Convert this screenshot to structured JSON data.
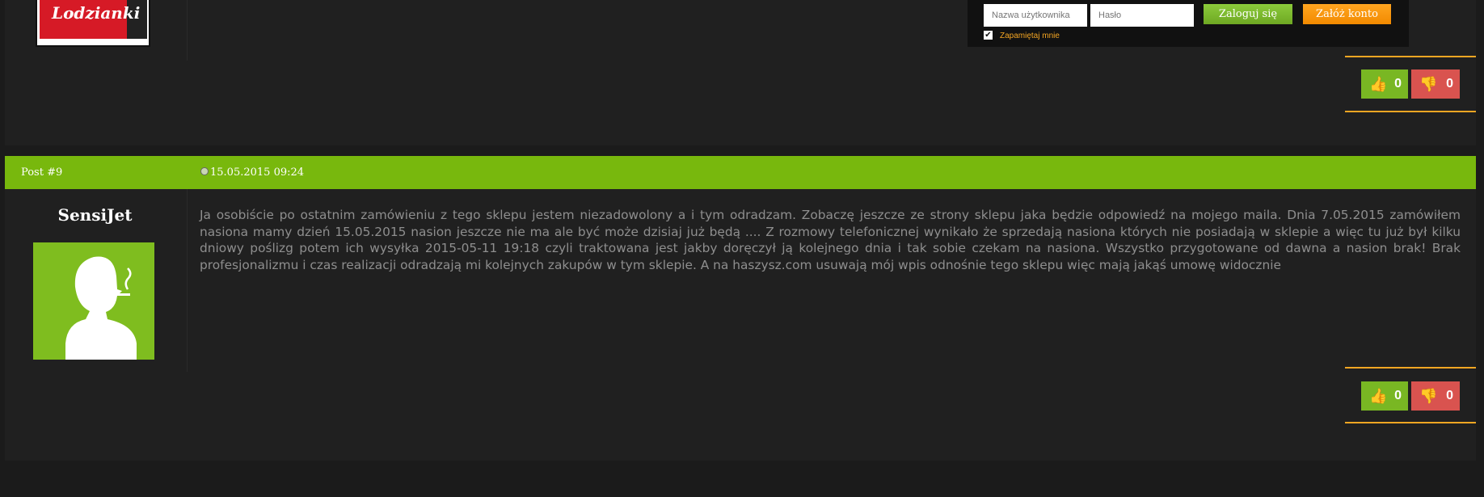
{
  "previous_post": {
    "avatar_text": "Lodzianki"
  },
  "login": {
    "username_placeholder": "Nazwa użytkownika",
    "password_placeholder": "Hasło",
    "login_button": "Zaloguj się",
    "register_button": "Załóż konto",
    "remember_label": "Zapamiętaj mnie",
    "remember_checked": true
  },
  "votes_previous": {
    "up": "0",
    "down": "0"
  },
  "post": {
    "number": "Post #9",
    "date": "15.05.2015 09:24",
    "author": "SensiJet",
    "body": "Ja osobiście po ostatnim zamówieniu z tego sklepu jestem niezadowolony a i tym odradzam. Zobaczę jeszcze ze strony sklepu jaka będzie odpowiedź na mojego maila. Dnia 7.05.2015 zamówiłem nasiona mamy dzień 15.05.2015 nasion jeszcze nie ma ale być może dzisiaj już będą .... Z rozmowy telefonicznej wynikało że sprzedają nasiona których nie posiadają w sklepie a więc tu już był kilku dniowy poślizg potem ich wysyłka 2015-05-11 19:18 czyli traktowana jest jakby doręczył ją kolejnego dnia i tak sobie czekam na nasiona. Wszystko przygotowane od dawna a nasion brak! Brak profesjonalizmu i czas realizacji odradzają mi kolejnych zakupów w tym sklepie. A na haszysz.com usuwają mój wpis odnośnie tego sklepu więc mają jakąś umowę widocznie",
    "votes": {
      "up": "0",
      "down": "0"
    }
  },
  "colors": {
    "accent_green": "#78b80d",
    "accent_orange": "#f5a623",
    "vote_up": "#79b723",
    "vote_down": "#d9534f"
  }
}
